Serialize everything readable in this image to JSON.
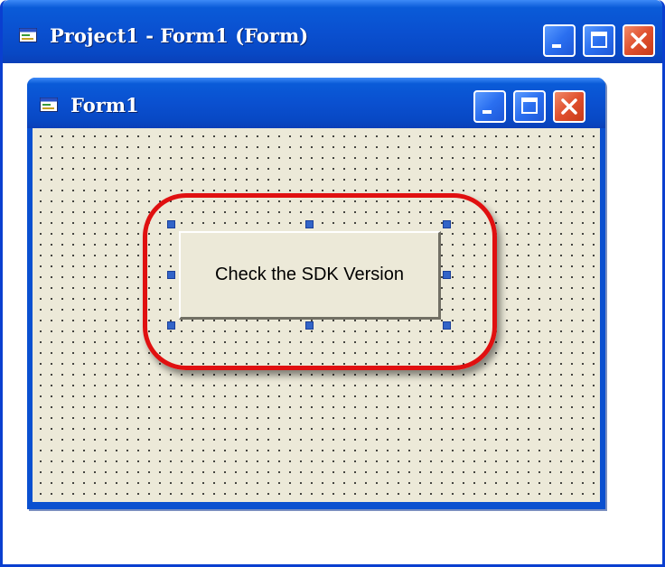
{
  "outer_window": {
    "title": "Project1 - Form1 (Form)",
    "icon": "form-icon",
    "controls": [
      "minimize-icon",
      "maximize-icon",
      "close-icon"
    ]
  },
  "form_window": {
    "title": "Form1",
    "icon": "form-icon",
    "controls": [
      "minimize-icon",
      "maximize-icon",
      "close-icon"
    ]
  },
  "form": {
    "button_label": "Check the SDK Version",
    "selected": true,
    "highlight_color": "#e01010"
  },
  "colors": {
    "titlebar": "#0a50d0",
    "close": "#e0502e",
    "form_background": "#ece9d8",
    "selection_handle": "#3264c8"
  }
}
